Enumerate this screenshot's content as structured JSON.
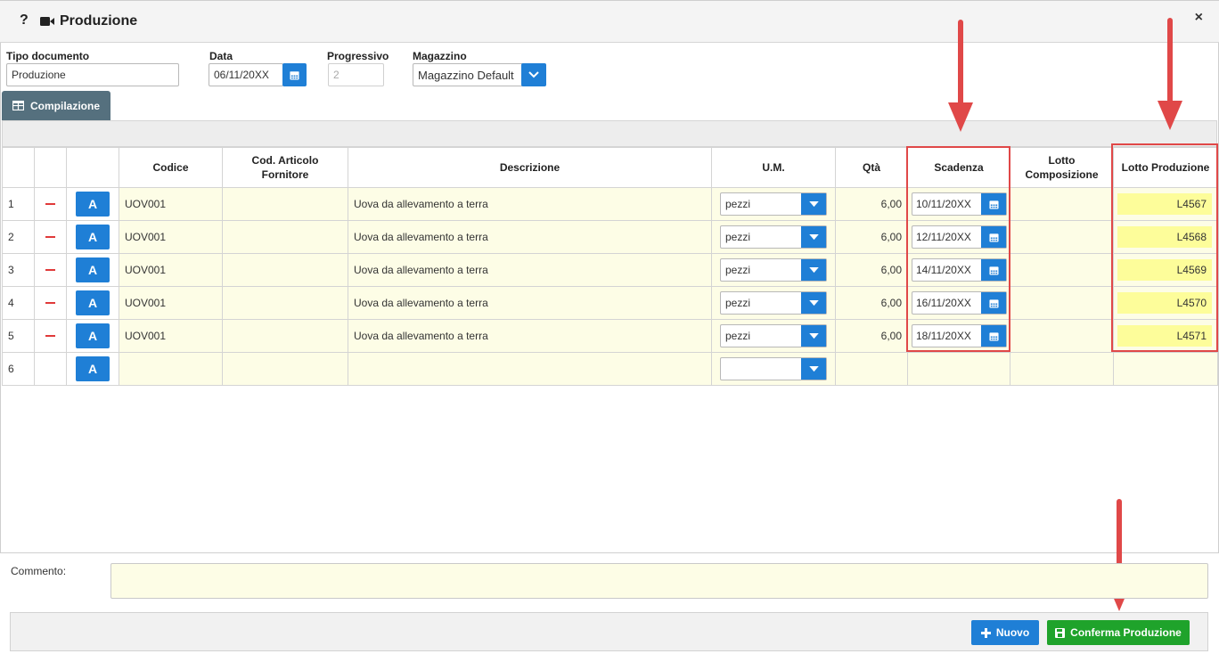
{
  "window": {
    "help": "?",
    "title": "Produzione",
    "close": "×"
  },
  "form": {
    "tipo_label": "Tipo documento",
    "tipo_value": "Produzione",
    "data_label": "Data",
    "data_value": "06/11/20XX",
    "progressivo_label": "Progressivo",
    "progressivo_value": "2",
    "magazzino_label": "Magazzino",
    "magazzino_value": "Magazzino Default"
  },
  "tab": {
    "label": "Compilazione"
  },
  "table": {
    "headers": {
      "codice": "Codice",
      "cod_articolo": "Cod. Articolo Fornitore",
      "descrizione": "Descrizione",
      "um": "U.M.",
      "qta": "Qtà",
      "scadenza": "Scadenza",
      "lotto_comp": "Lotto Composizione",
      "lotto_prod": "Lotto Produzione"
    },
    "button_a": "A",
    "rows": [
      {
        "n": "1",
        "codice": "UOV001",
        "descrizione": "Uova da allevamento a terra",
        "um": "pezzi",
        "qta": "6,00",
        "scadenza": "10/11/20XX",
        "lotto": "L4567"
      },
      {
        "n": "2",
        "codice": "UOV001",
        "descrizione": "Uova da allevamento a terra",
        "um": "pezzi",
        "qta": "6,00",
        "scadenza": "12/11/20XX",
        "lotto": "L4568"
      },
      {
        "n": "3",
        "codice": "UOV001",
        "descrizione": "Uova da allevamento a terra",
        "um": "pezzi",
        "qta": "6,00",
        "scadenza": "14/11/20XX",
        "lotto": "L4569"
      },
      {
        "n": "4",
        "codice": "UOV001",
        "descrizione": "Uova da allevamento a terra",
        "um": "pezzi",
        "qta": "6,00",
        "scadenza": "16/11/20XX",
        "lotto": "L4570"
      },
      {
        "n": "5",
        "codice": "UOV001",
        "descrizione": "Uova da allevamento a terra",
        "um": "pezzi",
        "qta": "6,00",
        "scadenza": "18/11/20XX",
        "lotto": "L4571"
      }
    ],
    "empty_row_n": "6"
  },
  "comment": {
    "label": "Commento:"
  },
  "footer": {
    "nuovo": "Nuovo",
    "conferma": "Conferma Produzione"
  },
  "colors": {
    "accent": "#1f7fd6",
    "confirm": "#1fa32b",
    "highlight": "#e04848",
    "row_bg": "#fdfde6",
    "lotto_bg": "#fdfd9a"
  }
}
